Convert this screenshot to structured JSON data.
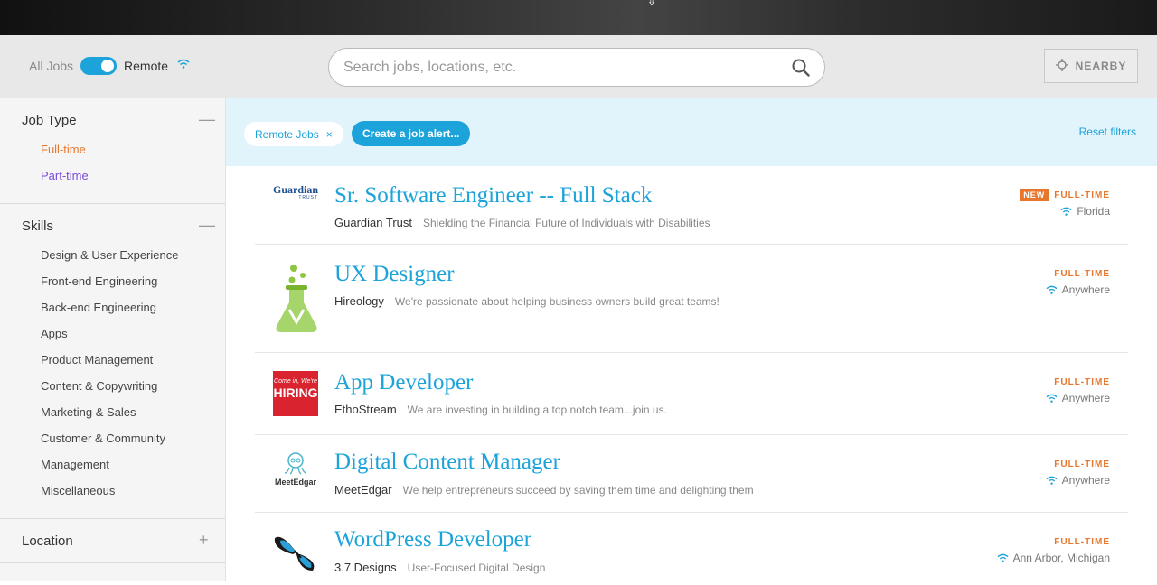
{
  "toolbar": {
    "all_jobs_label": "All Jobs",
    "remote_label": "Remote",
    "remote_enabled": true,
    "search_placeholder": "Search jobs, locations, etc.",
    "nearby_label": "NEARBY"
  },
  "sidebar": {
    "job_type": {
      "title": "Job Type",
      "items": [
        "Full-time",
        "Part-time"
      ]
    },
    "skills": {
      "title": "Skills",
      "items": [
        "Design & User Experience",
        "Front-end Engineering",
        "Back-end Engineering",
        "Apps",
        "Product Management",
        "Content & Copywriting",
        "Marketing & Sales",
        "Customer & Community",
        "Management",
        "Miscellaneous"
      ]
    },
    "location": {
      "title": "Location"
    }
  },
  "filters": {
    "chip_label": "Remote Jobs",
    "chip_close": "×",
    "alert_label": "Create a job alert...",
    "reset_label": "Reset filters"
  },
  "jobs": [
    {
      "title": "Sr. Software Engineer -- Full Stack",
      "company": "Guardian Trust",
      "tagline": "Shielding the Financial Future of Individuals with Disabilities",
      "type": "FULL-TIME",
      "location": "Florida",
      "badge": "NEW",
      "logo_text": "Guardian",
      "logo_subtext": "TRUST"
    },
    {
      "title": "UX Designer",
      "company": "Hireology",
      "tagline": "We're passionate about helping business owners build great teams!",
      "type": "FULL-TIME",
      "location": "Anywhere"
    },
    {
      "title": "App Developer",
      "company": "EthoStream",
      "tagline": "We are investing in building a top notch team...join us.",
      "type": "FULL-TIME",
      "location": "Anywhere",
      "logo_text": "Come in, We're",
      "logo_subtext": "HIRING"
    },
    {
      "title": "Digital Content Manager",
      "company": "MeetEdgar",
      "tagline": "We help entrepreneurs succeed by saving them time and delighting them",
      "type": "FULL-TIME",
      "location": "Anywhere",
      "logo_text": "MeetEdgar"
    },
    {
      "title": "WordPress Developer",
      "company": "3.7 Designs",
      "tagline": "User-Focused Digital Design",
      "type": "FULL-TIME",
      "location": "Ann Arbor, Michigan"
    }
  ],
  "colors": {
    "accent": "#1ca3d9",
    "orange": "#e8772e",
    "purple": "#7b4bd8"
  }
}
